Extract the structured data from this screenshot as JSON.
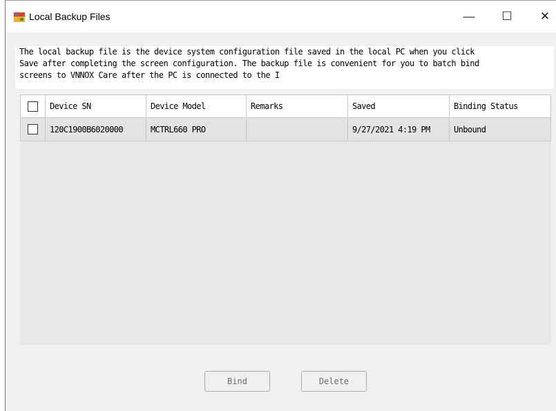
{
  "window": {
    "title": "Local Backup Files",
    "controls": {
      "minimize": "—",
      "maximize": "☐",
      "close": "✕"
    }
  },
  "description": [
    "The local backup file is the device system configuration file saved in the local PC when you click",
    "Save after completing the screen configuration. The backup file is convenient for you to batch bind",
    "screens to VNNOX Care after the PC is connected to the I"
  ],
  "table": {
    "columns": [
      "Device SN",
      "Device Model",
      "Remarks",
      "Saved",
      "Binding Status"
    ],
    "rows": [
      {
        "device_sn": "120C1900B6020000",
        "device_model": "MCTRL660 PRO",
        "remarks": "",
        "saved": "9/27/2021 4:19 PM",
        "binding_status": "Unbound"
      }
    ]
  },
  "buttons": {
    "bind": "Bind",
    "delete": "Delete"
  }
}
